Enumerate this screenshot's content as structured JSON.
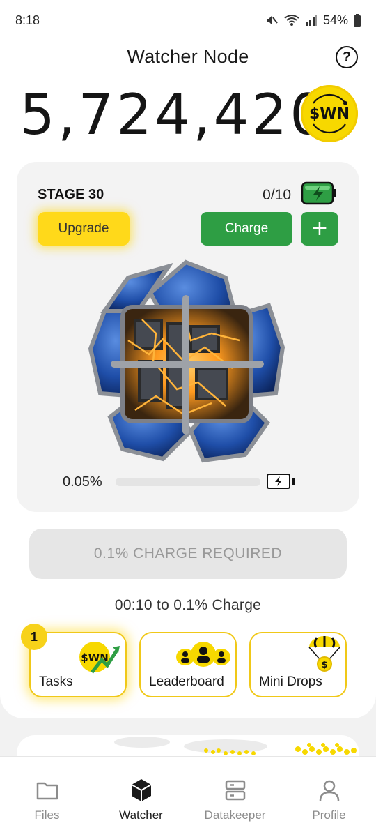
{
  "status_bar": {
    "time": "8:18",
    "battery": "54%"
  },
  "header": {
    "title": "Watcher Node",
    "help_icon": "question-circle-icon"
  },
  "balance": {
    "amount": "5,724,420",
    "coin_label": "$WN",
    "coin_color": "#f7d800"
  },
  "stage_card": {
    "stage": "STAGE 30",
    "charges": "0/10",
    "upgrade_label": "Upgrade",
    "charge_label": "Charge",
    "plus_label": "+",
    "progress_text": "0.05%",
    "progress_fraction": 0.0005
  },
  "charge_required_label": "0.1% CHARGE REQUIRED",
  "timer_text": "00:10 to 0.1% Charge",
  "tiles": {
    "tasks": {
      "label": "Tasks",
      "badge": "1",
      "icon_text": "$WN"
    },
    "leaderboard": {
      "label": "Leaderboard"
    },
    "mini_drops": {
      "label": "Mini Drops",
      "icon_text": "$"
    }
  },
  "nav": {
    "files": "Files",
    "watcher": "Watcher",
    "datakeeper": "Datakeeper",
    "profile": "Profile"
  },
  "colors": {
    "accent_yellow": "#ffd91a",
    "accent_green": "#2e9e44",
    "node_blue": "#1f4ea8",
    "energy_orange": "#ff9a1f"
  }
}
